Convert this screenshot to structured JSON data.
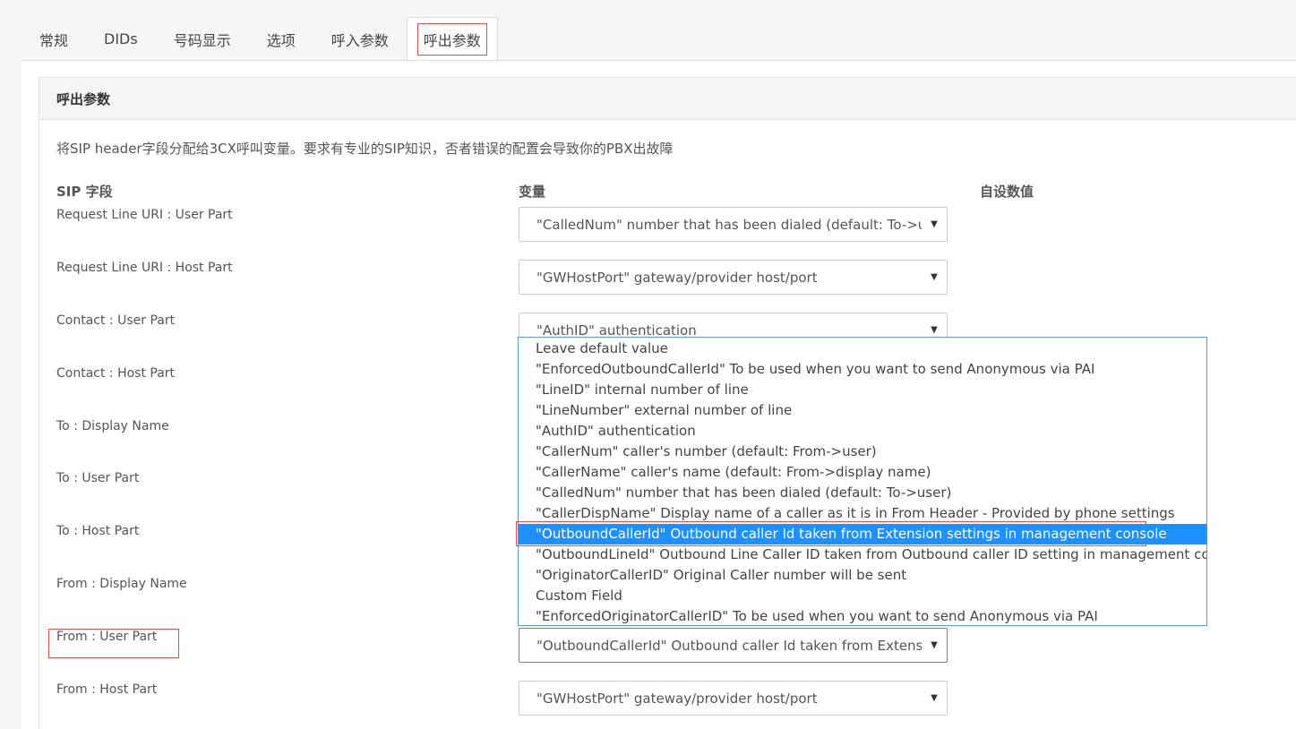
{
  "tabs": [
    {
      "label": "常规"
    },
    {
      "label": "DIDs"
    },
    {
      "label": "号码显示"
    },
    {
      "label": "选项"
    },
    {
      "label": "呼入参数"
    },
    {
      "label": "呼出参数"
    }
  ],
  "panel": {
    "title": "呼出参数",
    "description": "将SIP header字段分配给3CX呼叫变量。要求有专业的SIP知识，否者错误的配置会导致你的PBX出故障",
    "columns": {
      "sip_field": "SIP 字段",
      "variable": "变量",
      "custom_value": "自设数值"
    }
  },
  "rows": [
    {
      "label": "Request Line URI : User Part",
      "value": "\"CalledNum\" number that has been dialed (default: To->use"
    },
    {
      "label": "Request Line URI : Host Part",
      "value": "\"GWHostPort\" gateway/provider host/port"
    },
    {
      "label": "Contact : User Part",
      "value": "\"AuthID\" authentication"
    },
    {
      "label": "Contact : Host Part",
      "value": ""
    },
    {
      "label": "To : Display Name",
      "value": ""
    },
    {
      "label": "To : User Part",
      "value": ""
    },
    {
      "label": "To : Host Part",
      "value": ""
    },
    {
      "label": "From : Display Name",
      "value": ""
    },
    {
      "label": "From : User Part",
      "value": "\"OutboundCallerId\" Outbound caller Id taken from Extensio"
    },
    {
      "label": "From : Host Part",
      "value": "\"GWHostPort\" gateway/provider host/port"
    }
  ],
  "dropdown": {
    "selected_index": 9,
    "options": [
      "Leave default value",
      "\"EnforcedOutboundCallerId\" To be used when you want to send Anonymous via PAI",
      "\"LineID\" internal number of line",
      "\"LineNumber\" external number of line",
      "\"AuthID\" authentication",
      "\"CallerNum\" caller's number (default: From->user)",
      "\"CallerName\" caller's name (default: From->display name)",
      "\"CalledNum\" number that has been dialed (default: To->user)",
      "\"CallerDispName\" Display name of a caller as it is in From Header - Provided by phone settings",
      "\"OutboundCallerId\" Outbound caller Id taken from Extension settings in management console",
      "\"OutboundLineId\" Outbound Line Caller ID taken from Outbound caller ID setting in management console",
      "\"OriginatorCallerID\" Original Caller number will be sent",
      "Custom Field",
      "\"EnforcedOriginatorCallerID\" To be used when you want to send Anonymous via PAI"
    ]
  },
  "colors": {
    "accent": "#1e90ff",
    "highlight_border": "#d9534f"
  }
}
